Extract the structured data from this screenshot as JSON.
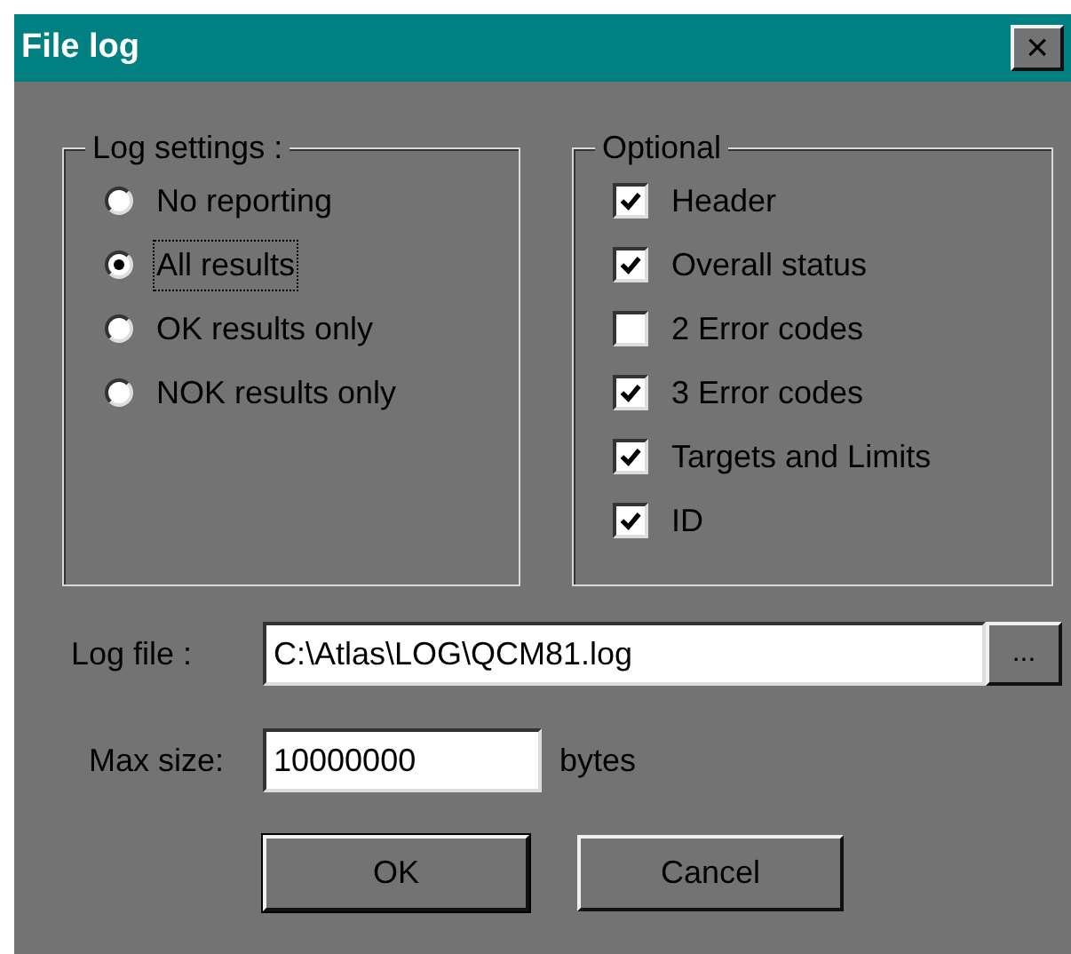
{
  "window": {
    "title": "File log",
    "close": "×"
  },
  "log_settings": {
    "title": "Log settings :",
    "options": [
      {
        "label": "No reporting",
        "selected": false
      },
      {
        "label": "All results",
        "selected": true
      },
      {
        "label": "OK results only",
        "selected": false
      },
      {
        "label": "NOK results only",
        "selected": false
      }
    ]
  },
  "optional": {
    "title": "Optional",
    "items": [
      {
        "label": "Header",
        "checked": true
      },
      {
        "label": "Overall status",
        "checked": true
      },
      {
        "label": "2 Error codes",
        "checked": false
      },
      {
        "label": "3 Error codes",
        "checked": true
      },
      {
        "label": "Targets and Limits",
        "checked": true
      },
      {
        "label": "ID",
        "checked": true
      }
    ]
  },
  "log_file": {
    "label": "Log file :",
    "value": "C:\\Atlas\\LOG\\QCM81.log",
    "browse": "..."
  },
  "max_size": {
    "label": "Max size:",
    "value": "10000000",
    "unit": "bytes"
  },
  "buttons": [
    "OK",
    "Cancel"
  ]
}
